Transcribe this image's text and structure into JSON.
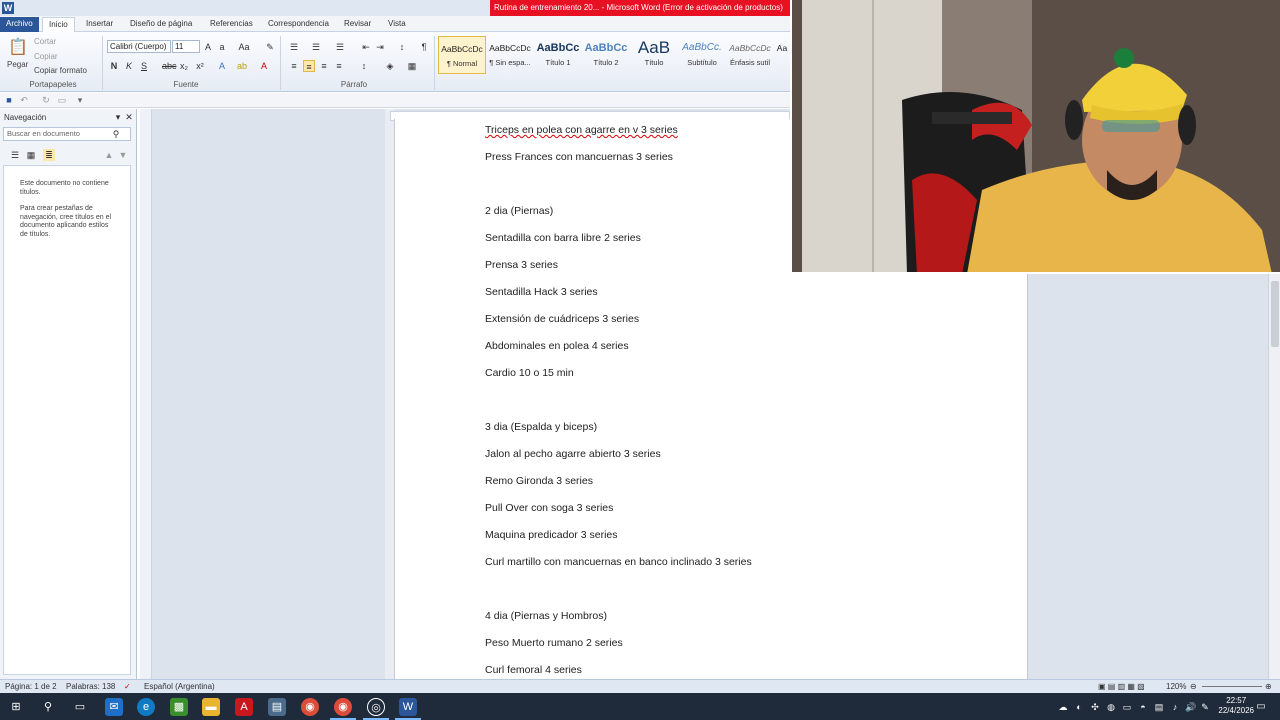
{
  "app": {
    "logo": "W",
    "title": "Rutina de entrenamiento 20... - Microsoft Word (Error de activación de productos)"
  },
  "tabs": [
    {
      "label": "Archivo"
    },
    {
      "label": "Inicio"
    },
    {
      "label": "Insertar"
    },
    {
      "label": "Diseño de página"
    },
    {
      "label": "Referencias"
    },
    {
      "label": "Correspondencia"
    },
    {
      "label": "Revisar"
    },
    {
      "label": "Vista"
    }
  ],
  "ribbon": {
    "clipboard": {
      "paste": "Pegar",
      "cut": "Cortar",
      "copy": "Copiar",
      "format_painter": "Copiar formato",
      "group_label": "Portapapeles"
    },
    "font": {
      "family": "Calibri (Cuerpo)",
      "size": "11",
      "group_label": "Fuente"
    },
    "paragraph": {
      "group_label": "Párrafo"
    },
    "styles": [
      {
        "sample": "AaBbCcDc",
        "name": "¶ Normal"
      },
      {
        "sample": "AaBbCcDc",
        "name": "¶ Sin espa..."
      },
      {
        "sample": "AaBbCc",
        "name": "Título 1"
      },
      {
        "sample": "AaBbCc",
        "name": "Título 2"
      },
      {
        "sample": "AaB",
        "name": "Título"
      },
      {
        "sample": "AaBbCc.",
        "name": "Subtítulo"
      },
      {
        "sample": "AaBbCcDc",
        "name": "Énfasis sutil"
      },
      {
        "sample": "Aa",
        "name": ""
      }
    ]
  },
  "nav": {
    "title": "Navegación",
    "search_placeholder": "Buscar en documento",
    "message1": "Este documento no contiene títulos.",
    "message2": "Para crear pestañas de navegación, cree títulos en el documento aplicando estilos de títulos."
  },
  "document": {
    "lines": [
      {
        "text": "Triceps en polea con agarre en v 3 series"
      },
      {
        "text": "Press Frances con mancuernas 3 series"
      },
      {
        "text": "2 dia (Piernas)"
      },
      {
        "text": "Sentadilla con barra libre 2 series"
      },
      {
        "text": "Prensa 3 series"
      },
      {
        "text": "Sentadilla Hack 3 series"
      },
      {
        "text": "Extensión de cuádriceps 3 series"
      },
      {
        "text": "Abdominales en polea 4 series"
      },
      {
        "text": "Cardio 10 o 15 min"
      },
      {
        "text": "3 dia (Espalda y biceps)"
      },
      {
        "text": "Jalon al pecho agarre abierto 3 series"
      },
      {
        "text": "Remo Gironda 3 series"
      },
      {
        "text": "Pull Over con soga 3 series"
      },
      {
        "text": "Maquina predicador 3 series"
      },
      {
        "text": "Curl martillo con mancuernas en banco inclinado 3 series"
      },
      {
        "text": "4 dia (Piernas y Hombros)"
      },
      {
        "text": "Peso Muerto rumano 2 series"
      },
      {
        "text": "Curl femoral 4 series"
      }
    ]
  },
  "status": {
    "page": "Página: 1 de 2",
    "words": "Palabras: 138",
    "language": "Español (Argentina)",
    "zoom": "120%"
  },
  "clock": {
    "time": "22:57",
    "date": "22/4/2026"
  },
  "colors": {
    "accent": "#2b579a",
    "title_bar": "#e81123",
    "taskbar": "#1f2a3a"
  }
}
